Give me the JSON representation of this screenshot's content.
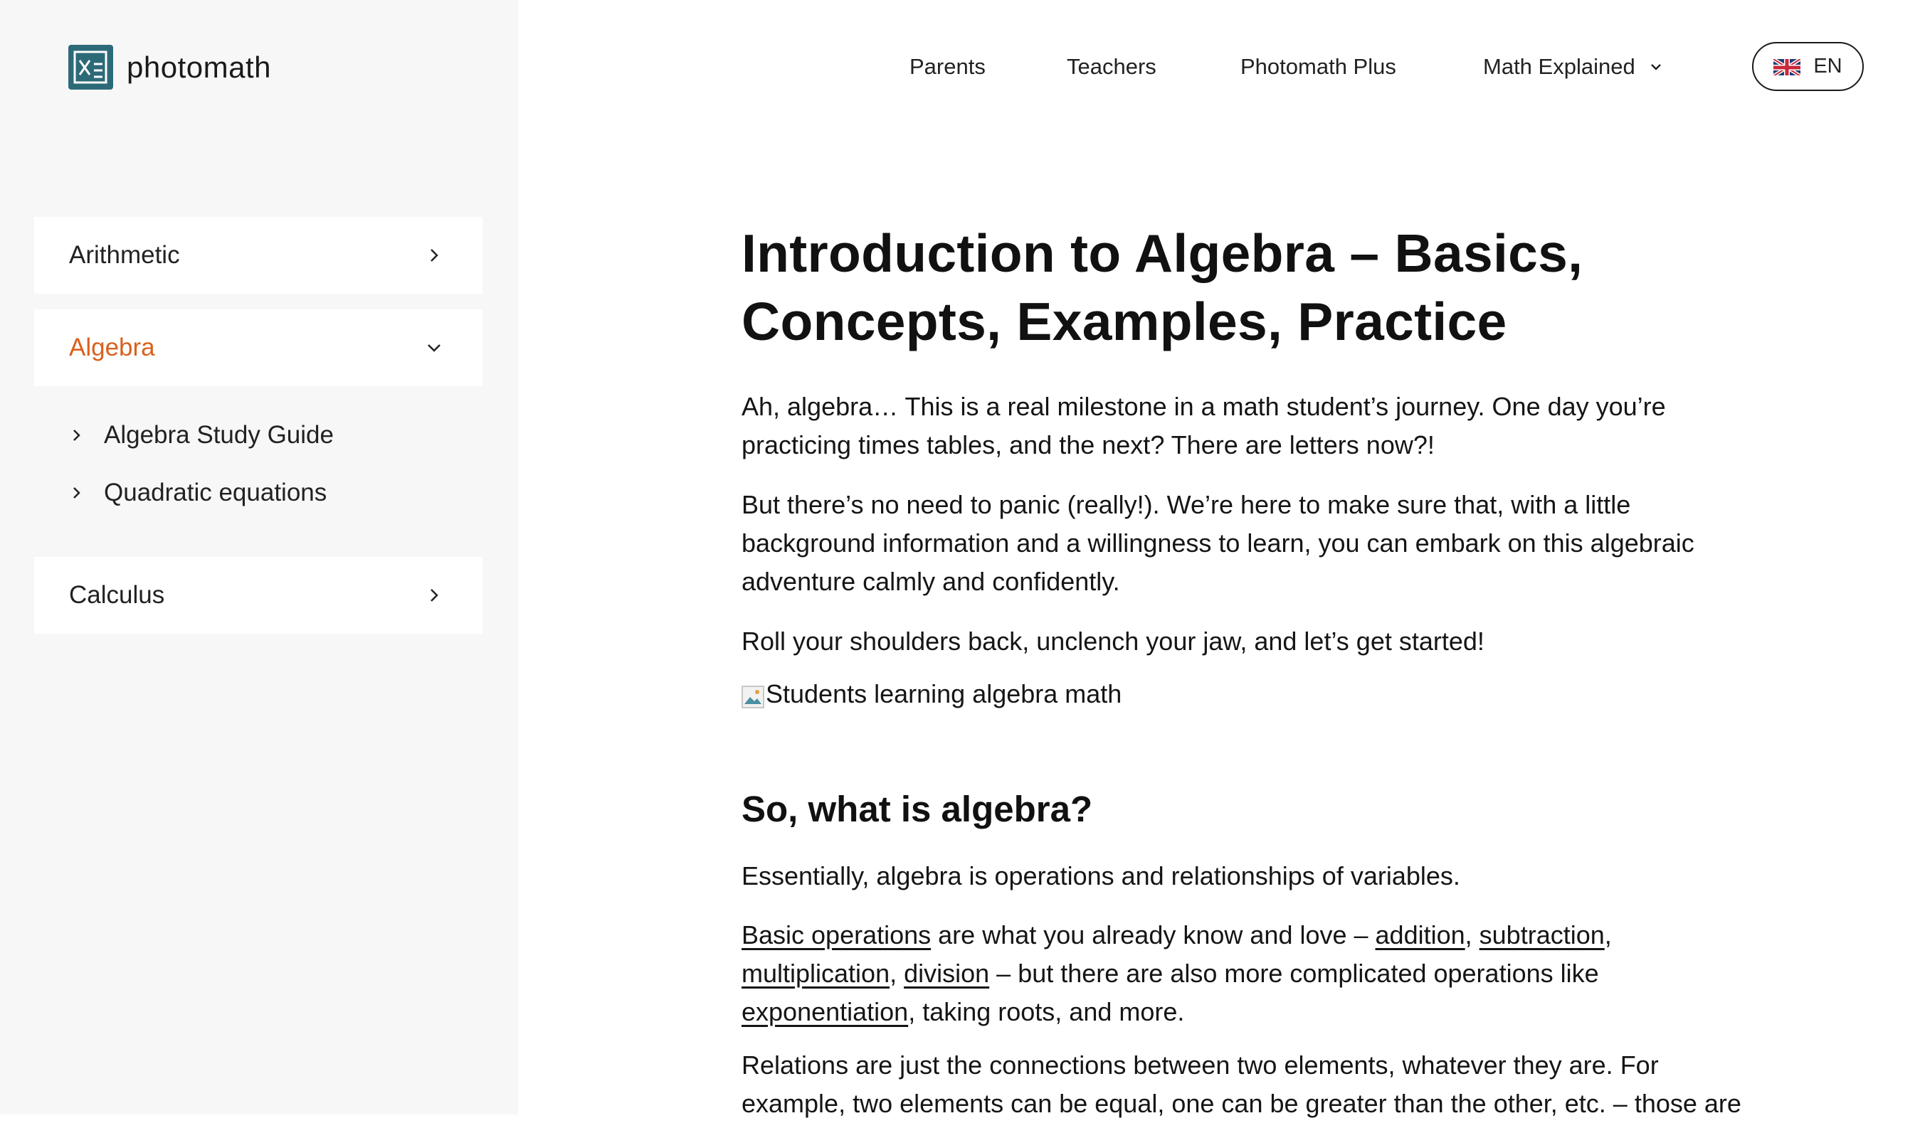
{
  "brand": {
    "name": "photomath",
    "accent": "#2d6a78"
  },
  "nav": {
    "links": [
      "Parents",
      "Teachers",
      "Photomath Plus",
      "Math Explained"
    ],
    "language": "EN"
  },
  "sidebar": {
    "cards": [
      {
        "label": "Arithmetic",
        "expanded": false
      },
      {
        "label": "Algebra",
        "expanded": true
      },
      {
        "label": "Calculus",
        "expanded": false
      }
    ],
    "algebra_subitems": [
      "Algebra Study Guide",
      "Quadratic equations"
    ],
    "active_color": "#d9611c"
  },
  "article": {
    "title": "Introduction to Algebra – Basics, Concepts, Examples, Practice",
    "intro1": "Ah, algebra… This is a real milestone in a math student’s journey. One day you’re practicing times tables, and the next? There are letters now?!",
    "intro2": "But there’s no need to panic (really!). We’re here to make sure that, with a little background information and a willingness to learn, you can embark on this algebraic adventure calmly and confidently.",
    "intro3": "Roll your shoulders back, unclench your jaw, and let’s get started!",
    "image_alt": "Students learning algebra math",
    "section_heading": "So, what is algebra?",
    "section_p1": "Essentially, algebra is operations and relationships of variables.",
    "ops": {
      "link_basic": "Basic operations",
      "text_a": " are what you already know and love – ",
      "link_addition": "addition",
      "sep1": ", ",
      "link_subtraction": "subtraction",
      "sep2": ", ",
      "link_multiplication": "multiplication",
      "sep3": ", ",
      "link_division": "division",
      "text_b": " – but there are also more complicated operations like ",
      "link_exponentiation": "exponentiation",
      "text_c": ", taking roots, and more."
    },
    "relations_p": "Relations are just the connections between two elements, whatever they are. For example, two elements can be equal, one can be greater than the other, etc. – those are"
  }
}
